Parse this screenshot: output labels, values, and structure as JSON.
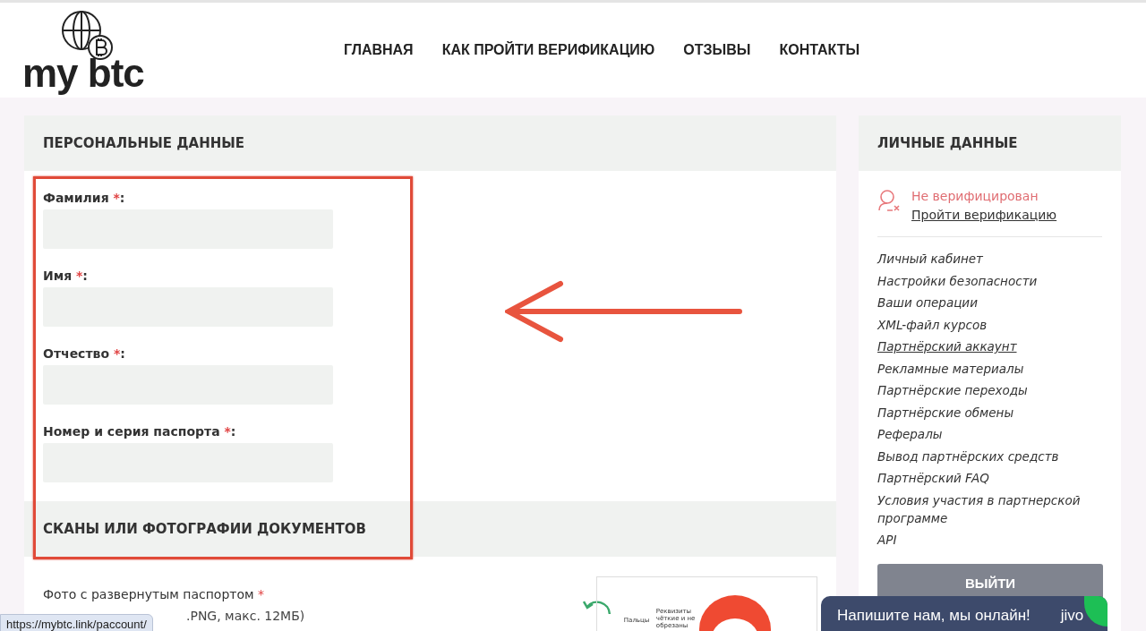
{
  "header": {
    "logo_text": "my btc",
    "nav": [
      {
        "label": "ГЛАВНАЯ"
      },
      {
        "label": "КАК ПРОЙТИ ВЕРИФИКАЦИЮ"
      },
      {
        "label": "ОТЗЫВЫ"
      },
      {
        "label": "КОНТАКТЫ"
      }
    ]
  },
  "personal_data": {
    "title": "ПЕРСОНАЛЬНЫЕ ДАННЫЕ",
    "fields": [
      {
        "label": "Фамилия",
        "required_mark": "*"
      },
      {
        "label": "Имя",
        "required_mark": "*"
      },
      {
        "label": "Отчество",
        "required_mark": "*"
      },
      {
        "label": "Номер и серия паспорта",
        "required_mark": "*"
      }
    ],
    "colon": ":"
  },
  "documents": {
    "title": "СКАНЫ ИЛИ ФОТОГРАФИИ ДОКУМЕНТОВ",
    "upload_label": "Фото с развернутым паспортом",
    "required_mark": "*",
    "hint": ".PNG, макс. 12МБ)",
    "illustration_texts": [
      "Пальцы",
      "Реквизиты чёткие и не обрезаны"
    ]
  },
  "sidebar": {
    "title": "ЛИЧНЫЕ ДАННЫЕ",
    "status": "Не верифицирован",
    "verify_link": "Пройти верификацию",
    "menu": [
      {
        "label": "Личный кабинет",
        "selected": false
      },
      {
        "label": "Настройки безопасности",
        "selected": false
      },
      {
        "label": "Ваши операции",
        "selected": false
      },
      {
        "label": "XML-файл курсов",
        "selected": false
      },
      {
        "label": "Партнёрский аккаунт",
        "selected": true
      },
      {
        "label": "Рекламные материалы",
        "selected": false
      },
      {
        "label": "Партнёрские переходы",
        "selected": false
      },
      {
        "label": "Партнёрские обмены",
        "selected": false
      },
      {
        "label": "Рефералы",
        "selected": false
      },
      {
        "label": "Вывод партнёрских средств",
        "selected": false
      },
      {
        "label": "Партнёрский FAQ",
        "selected": false
      },
      {
        "label": "Условия участия в партнерской программе",
        "selected": false
      },
      {
        "label": "API",
        "selected": false
      }
    ],
    "logout": "ВЫЙТИ"
  },
  "chat_widget": {
    "text": "Напишите нам, мы онлайн!",
    "brand": "jivo"
  },
  "status_url": "https://mybtc.link/paccount/"
}
